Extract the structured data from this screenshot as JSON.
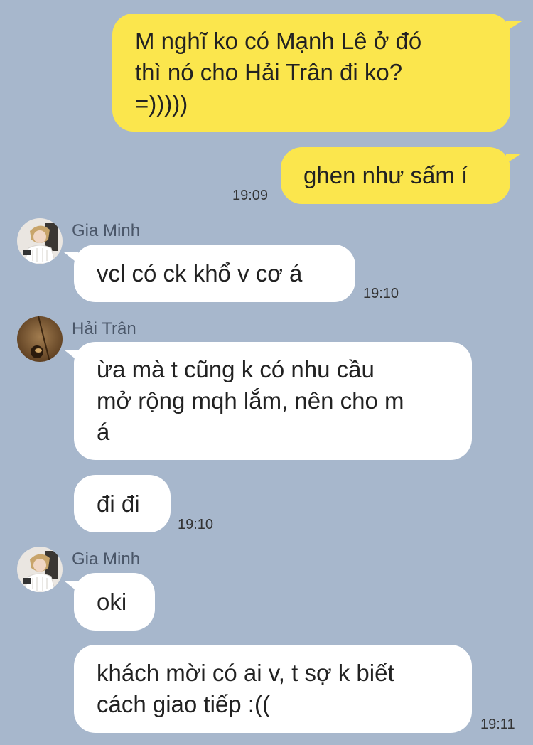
{
  "messages": [
    {
      "sender": "",
      "text": "M nghĩ ko có Mạnh Lê ở đó\nthì nó cho Hải Trân đi ko?\n=)))))",
      "time": ""
    },
    {
      "sender": "",
      "text": "ghen như sấm í",
      "time": "19:09"
    },
    {
      "sender": "Gia Minh",
      "text": "vcl có ck khổ v cơ á",
      "time": "19:10"
    },
    {
      "sender": "Hải Trân",
      "text": "ừa mà t cũng k có nhu cầu\nmở rộng mqh lắm, nên cho m\ná",
      "time": ""
    },
    {
      "sender": "",
      "text": "đi đi",
      "time": "19:10"
    },
    {
      "sender": "Gia Minh",
      "text": "oki",
      "time": ""
    },
    {
      "sender": "",
      "text": "khách mời có ai v, t sợ k biết\ncách giao tiếp :((",
      "time": "19:11"
    }
  ],
  "colors": {
    "background": "#a7b7cc",
    "outgoing_bubble": "#fbe64d",
    "incoming_bubble": "#ffffff"
  }
}
